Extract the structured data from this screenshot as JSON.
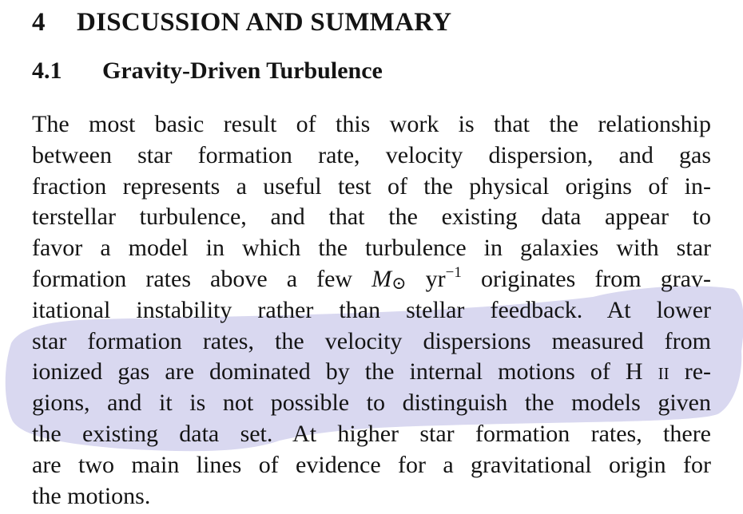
{
  "section": {
    "number": "4",
    "title": "DISCUSSION AND SUMMARY"
  },
  "subsection": {
    "number": "4.1",
    "title": "Gravity-Driven Turbulence"
  },
  "paragraph": {
    "lines": [
      "The most basic result of this work is that the relationship",
      "between star formation rate, velocity dispersion, and gas",
      "fraction represents a useful test of the physical origins of in-",
      "terstellar turbulence, and that the existing data appear to",
      "favor a model in which the turbulence in galaxies with star",
      null,
      "itational instability rather than stellar feedback. At lower",
      "star formation rates, the velocity dispersions measured from",
      null,
      "gions, and it is not possible to distinguish the models given",
      "the existing data set. At higher star formation rates, there",
      "are two main lines of evidence for a gravitational origin for",
      "the motions."
    ],
    "line6": {
      "before": "formation rates above a few ",
      "mass_symbol": "M",
      "sun_symbol": "⊙",
      "unit": " yr",
      "exponent": "−1",
      "after": " originates from grav-"
    },
    "line9": {
      "before": "ionized gas are dominated by the internal motions of H ",
      "roman": "ii",
      "after": " re-"
    }
  },
  "highlight": {
    "color": "#d9d8f0",
    "description_note": ""
  }
}
